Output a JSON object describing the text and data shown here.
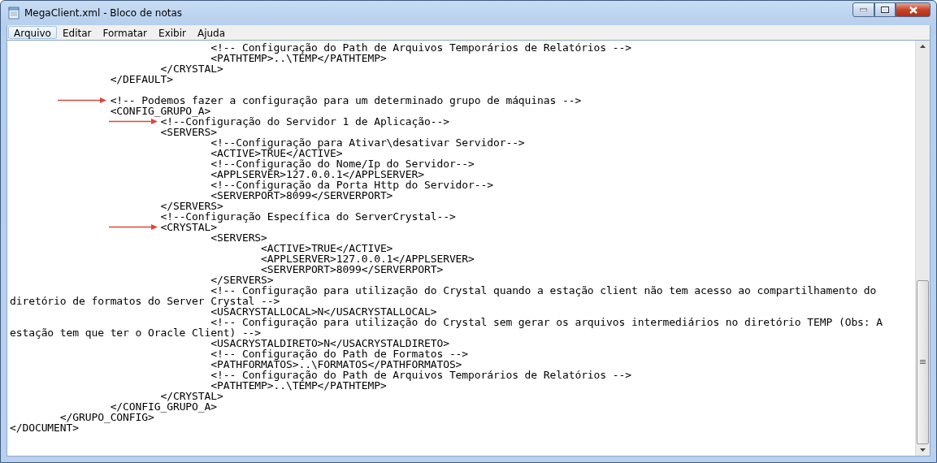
{
  "window": {
    "title": "MegaClient.xml - Bloco de notas"
  },
  "menu": [
    {
      "label": "Arquivo",
      "selected": true
    },
    {
      "label": "Editar",
      "selected": false
    },
    {
      "label": "Formatar",
      "selected": false
    },
    {
      "label": "Exibir",
      "selected": false
    },
    {
      "label": "Ajuda",
      "selected": false
    }
  ],
  "editor": {
    "lines": [
      {
        "text": "\t\t\t\t<!-- Configuração do Path de Arquivos Temporários de Relatórios -->",
        "arrow": false
      },
      {
        "text": "\t\t\t\t<PATHTEMP>..\\TEMP</PATHTEMP>",
        "arrow": false
      },
      {
        "text": "\t\t\t</CRYSTAL>",
        "arrow": false
      },
      {
        "text": "\t\t</DEFAULT>",
        "arrow": false
      },
      {
        "arrow": false
      },
      {
        "text": "\t\t<!-- Podemos fazer a configuração para um determinado grupo de máquinas -->",
        "arrow": true
      },
      {
        "text": "\t\t<CONFIG_GRUPO_A>",
        "arrow": false
      },
      {
        "text": "\t\t\t<!--Configuração do Servidor 1 de Aplicação-->",
        "arrow": true
      },
      {
        "text": "\t\t\t<SERVERS>",
        "arrow": false
      },
      {
        "text": "\t\t\t\t<!--Configuração para Ativar\\desativar Servidor-->",
        "arrow": false
      },
      {
        "text": "\t\t\t\t<ACTIVE>TRUE</ACTIVE>",
        "arrow": false
      },
      {
        "text": "\t\t\t\t<!--Configuração do Nome/Ip do Servidor-->",
        "arrow": false
      },
      {
        "text": "\t\t\t\t<APPLSERVER>127.0.0.1</APPLSERVER>",
        "arrow": false
      },
      {
        "text": "\t\t\t\t<!--Configuração da Porta Http do Servidor-->",
        "arrow": false
      },
      {
        "text": "\t\t\t\t<SERVERPORT>8099</SERVERPORT>",
        "arrow": false
      },
      {
        "text": "\t\t\t</SERVERS>",
        "arrow": false
      },
      {
        "text": "\t\t\t<!--Configuração Específica do ServerCrystal-->",
        "arrow": false
      },
      {
        "text": "\t\t\t<CRYSTAL>",
        "arrow": true
      },
      {
        "text": "\t\t\t\t<SERVERS>",
        "arrow": false
      },
      {
        "text": "\t\t\t\t\t<ACTIVE>TRUE</ACTIVE>",
        "arrow": false
      },
      {
        "text": "\t\t\t\t\t<APPLSERVER>127.0.0.1</APPLSERVER>",
        "arrow": false
      },
      {
        "text": "\t\t\t\t\t<SERVERPORT>8099</SERVERPORT>",
        "arrow": false
      },
      {
        "text": "\t\t\t\t</SERVERS>",
        "arrow": false
      },
      {
        "text": "\t\t\t\t<!-- Configuração para utilização do Crystal quando a estação client não tem acesso ao compartilhamento do",
        "arrow": false
      },
      {
        "text": "diretório de formatos do Server Crystal -->",
        "arrow": false
      },
      {
        "text": "\t\t\t\t<USACRYSTALLOCAL>N</USACRYSTALLOCAL>",
        "arrow": false
      },
      {
        "text": "\t\t\t\t<!-- Configuração para utilização do Crystal sem gerar os arquivos intermediários no diretório TEMP (Obs: A",
        "arrow": false
      },
      {
        "text": "estação tem que ter o Oracle Client) -->",
        "arrow": false
      },
      {
        "text": "\t\t\t\t<USACRYSTALDIRETO>N</USACRYSTALDIRETO>",
        "arrow": false
      },
      {
        "text": "\t\t\t\t<!-- Configuração do Path de Formatos -->",
        "arrow": false
      },
      {
        "text": "\t\t\t\t<PATHFORMATOS>..\\FORMATOS</PATHFORMATOS>",
        "arrow": false
      },
      {
        "text": "\t\t\t\t<!-- Configuração do Path de Arquivos Temporários de Relatórios -->",
        "arrow": false
      },
      {
        "text": "\t\t\t\t<PATHTEMP>..\\TEMP</PATHTEMP>",
        "arrow": false
      },
      {
        "text": "\t\t\t</CRYSTAL>",
        "arrow": false
      },
      {
        "text": "\t\t</CONFIG_GRUPO_A>",
        "arrow": false
      },
      {
        "text": "\t</GRUPO_CONFIG>",
        "arrow": false
      },
      {
        "text": "</DOCUMENT>",
        "arrow": false
      }
    ]
  }
}
